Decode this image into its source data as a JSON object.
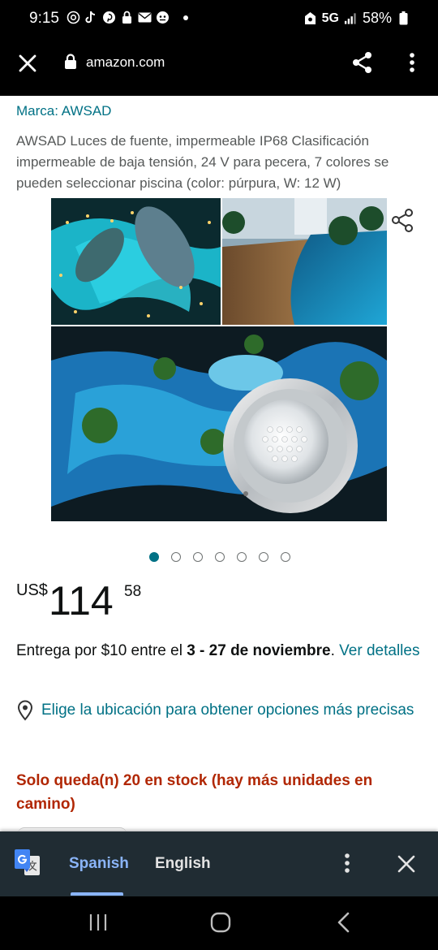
{
  "status_bar": {
    "time": "9:15",
    "network": "5G",
    "battery": "58%"
  },
  "browser": {
    "url": "amazon.com"
  },
  "product": {
    "brand": "Marca: AWSAD",
    "title": "AWSAD Luces de fuente, impermeable IP68 Clasificación impermeable de baja tensión, 24 V para pecera, 7 colores se pueden seleccionar piscina (color: púrpura, W: 12 W)",
    "image_count": 7,
    "active_image": 1
  },
  "price": {
    "currency": "US$",
    "whole": "114",
    "fraction": "58"
  },
  "delivery": {
    "prefix": "Entrega por $10 entre el ",
    "dates": "3 - 27 de noviembre",
    "suffix": ". ",
    "link": "Ver detalles"
  },
  "location": {
    "text": "Elige la ubicación para obtener opciones más precisas"
  },
  "stock": {
    "text": "Solo queda(n) 20 en stock (hay más unidades en camino)"
  },
  "translate_bar": {
    "tabs": [
      "Spanish",
      "English"
    ],
    "active_tab": "Spanish"
  },
  "colors": {
    "link": "#007185",
    "stock": "#B12704",
    "price": "#0F1111",
    "translate_bg": "#202c33",
    "translate_active": "#8ab4f8"
  }
}
